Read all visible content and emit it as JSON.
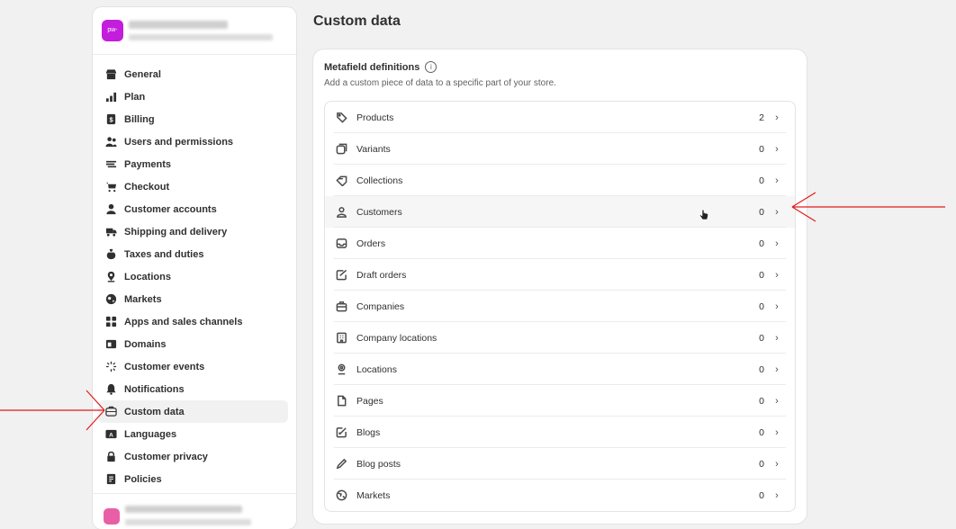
{
  "store": {
    "avatar_text": "pw-"
  },
  "sidebar": {
    "items": [
      {
        "label": "General",
        "icon": "store-icon"
      },
      {
        "label": "Plan",
        "icon": "plan-bars-icon"
      },
      {
        "label": "Billing",
        "icon": "billing-icon"
      },
      {
        "label": "Users and permissions",
        "icon": "users-icon"
      },
      {
        "label": "Payments",
        "icon": "payments-icon"
      },
      {
        "label": "Checkout",
        "icon": "cart-icon"
      },
      {
        "label": "Customer accounts",
        "icon": "person-icon"
      },
      {
        "label": "Shipping and delivery",
        "icon": "truck-icon"
      },
      {
        "label": "Taxes and duties",
        "icon": "tax-bag-icon"
      },
      {
        "label": "Locations",
        "icon": "location-pin-icon"
      },
      {
        "label": "Markets",
        "icon": "globe-icon"
      },
      {
        "label": "Apps and sales channels",
        "icon": "apps-icon"
      },
      {
        "label": "Domains",
        "icon": "domain-icon"
      },
      {
        "label": "Customer events",
        "icon": "sparkle-icon"
      },
      {
        "label": "Notifications",
        "icon": "bell-icon"
      },
      {
        "label": "Custom data",
        "icon": "custom-data-icon",
        "active": true
      },
      {
        "label": "Languages",
        "icon": "language-icon"
      },
      {
        "label": "Customer privacy",
        "icon": "lock-icon"
      },
      {
        "label": "Policies",
        "icon": "policy-icon"
      }
    ]
  },
  "page": {
    "title": "Custom data"
  },
  "metafields": {
    "title": "Metafield definitions",
    "subtitle": "Add a custom piece of data to a specific part of your store.",
    "rows": [
      {
        "label": "Products",
        "count": "2",
        "icon": "tag-icon"
      },
      {
        "label": "Variants",
        "count": "0",
        "icon": "variants-icon"
      },
      {
        "label": "Collections",
        "count": "0",
        "icon": "collections-icon"
      },
      {
        "label": "Customers",
        "count": "0",
        "icon": "customer-icon"
      },
      {
        "label": "Orders",
        "count": "0",
        "icon": "inbox-icon"
      },
      {
        "label": "Draft orders",
        "count": "0",
        "icon": "draft-order-icon"
      },
      {
        "label": "Companies",
        "count": "0",
        "icon": "briefcase-icon"
      },
      {
        "label": "Company locations",
        "count": "0",
        "icon": "building-icon"
      },
      {
        "label": "Locations",
        "count": "0",
        "icon": "location-icon"
      },
      {
        "label": "Pages",
        "count": "0",
        "icon": "page-icon"
      },
      {
        "label": "Blogs",
        "count": "0",
        "icon": "blog-icon"
      },
      {
        "label": "Blog posts",
        "count": "0",
        "icon": "pen-icon"
      },
      {
        "label": "Markets",
        "count": "0",
        "icon": "globe-icon"
      }
    ]
  },
  "colors": {
    "accent_arrow": "#e21b1b",
    "store_avatar": "#c21edb"
  }
}
